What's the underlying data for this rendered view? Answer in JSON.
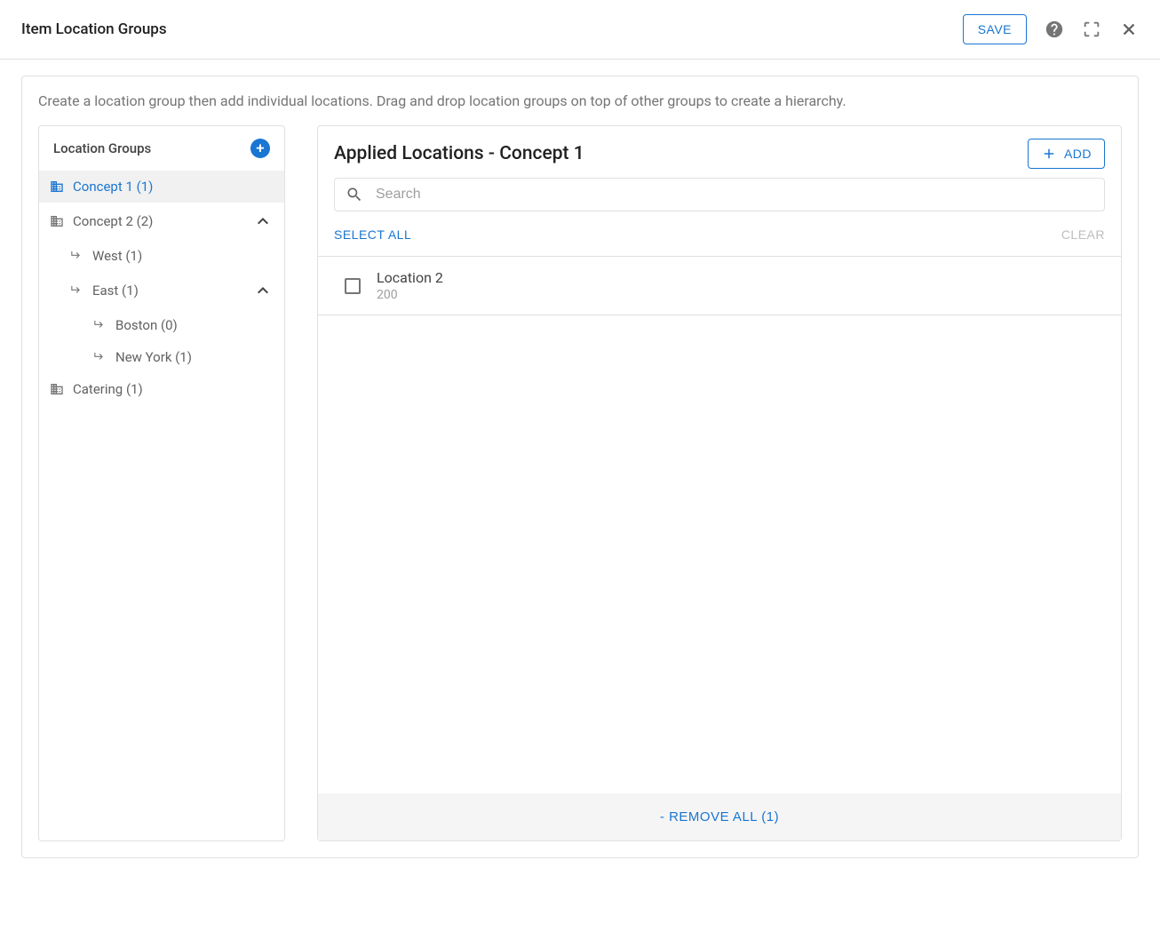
{
  "header": {
    "title": "Item Location Groups",
    "save_label": "SAVE"
  },
  "instructions": "Create a location group then add individual locations. Drag and drop location groups on top of other groups to create a hierarchy.",
  "sidebar": {
    "title": "Location Groups",
    "items": [
      {
        "label": "Concept 1 (1)",
        "type": "building",
        "selected": true,
        "indent": 0,
        "expandable": false
      },
      {
        "label": "Concept 2 (2)",
        "type": "building",
        "selected": false,
        "indent": 0,
        "expandable": true
      },
      {
        "label": "West (1)",
        "type": "sub",
        "selected": false,
        "indent": 1,
        "expandable": false
      },
      {
        "label": "East (1)",
        "type": "sub",
        "selected": false,
        "indent": 1,
        "expandable": true
      },
      {
        "label": "Boston (0)",
        "type": "sub",
        "selected": false,
        "indent": 2,
        "expandable": false
      },
      {
        "label": "New York (1)",
        "type": "sub",
        "selected": false,
        "indent": 2,
        "expandable": false
      },
      {
        "label": "Catering (1)",
        "type": "building",
        "selected": false,
        "indent": 0,
        "expandable": false
      }
    ]
  },
  "main": {
    "title": "Applied Locations - Concept 1",
    "add_label": "ADD",
    "search_placeholder": "Search",
    "select_all_label": "SELECT ALL",
    "clear_label": "CLEAR",
    "locations": [
      {
        "name": "Location 2",
        "id": "200"
      }
    ],
    "remove_all_label": "- REMOVE ALL (1)"
  }
}
